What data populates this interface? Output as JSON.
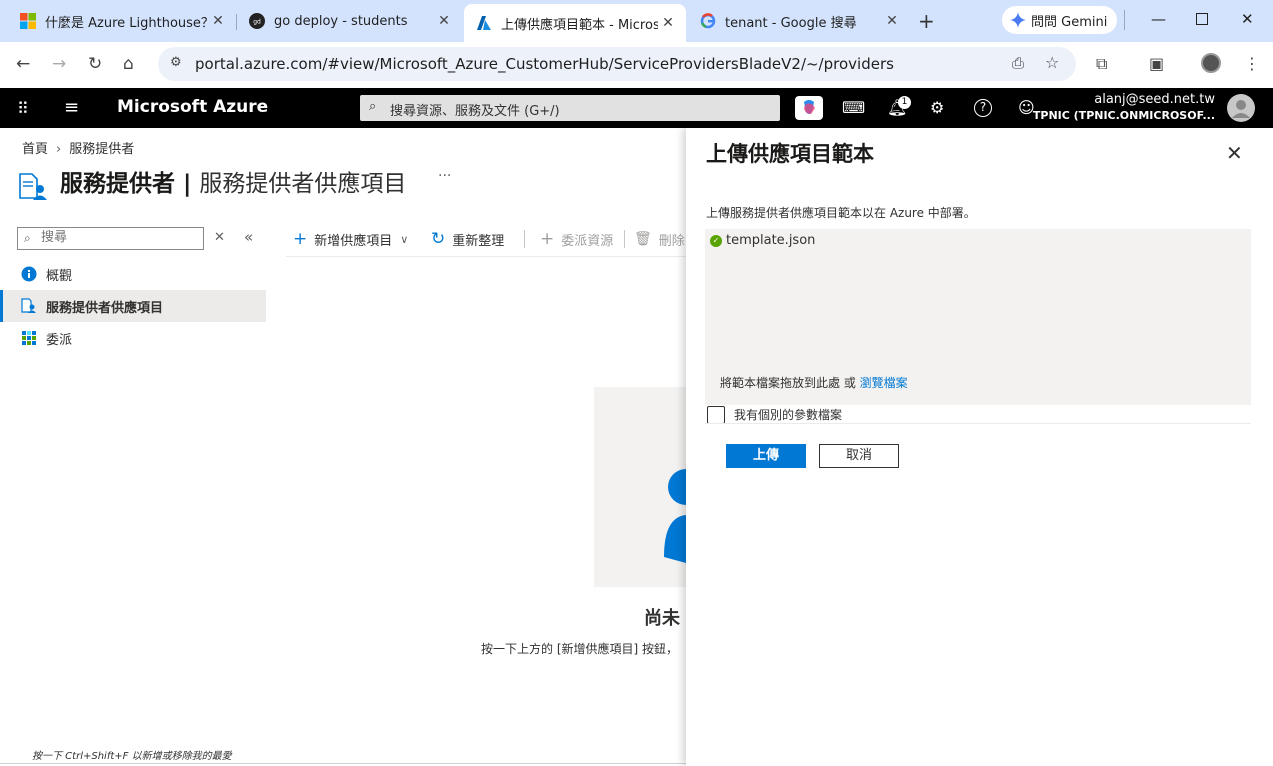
{
  "browser": {
    "tabs": [
      {
        "title": "什麼是 Azure Lighthouse？",
        "icon": "microsoft-icon"
      },
      {
        "title": "go deploy - students",
        "icon": "go-deploy-icon"
      },
      {
        "title": "上傳供應項目範本 - Microso",
        "icon": "azure-icon"
      },
      {
        "title": "tenant - Google 搜尋",
        "icon": "google-icon"
      }
    ],
    "gemini_label": "問問 Gemini",
    "url": "portal.azure.com/#view/Microsoft_Azure_CustomerHub/ServiceProvidersBladeV2/~/providers"
  },
  "azure": {
    "brand": "Microsoft Azure",
    "search_placeholder": "搜尋資源、服務及文件 (G+/)",
    "notification_count": "1",
    "account_email": "alanj@seed.net.tw",
    "account_tenant": "TPNIC (TPNIC.ONMICROSOF..."
  },
  "page": {
    "breadcrumb": [
      "首頁",
      "服務提供者"
    ],
    "title_main": "服務提供者",
    "title_sep": " | ",
    "title_sub": "服務提供者供應項目",
    "more": "···",
    "menu_search_placeholder": "搜尋",
    "menu_items": [
      {
        "label": "概觀",
        "icon": "info-icon"
      },
      {
        "label": "服務提供者供應項目",
        "icon": "service-provider-icon"
      },
      {
        "label": "委派",
        "icon": "delegation-icon"
      }
    ],
    "commands": {
      "add": "新增供應項目",
      "refresh": "重新整理",
      "delegate": "委派資源",
      "delete": "刪除"
    },
    "empty_title": "尚未",
    "empty_desc": "按一下上方的 [新增供應項目] 按鈕，",
    "hint": "按一下 Ctrl+Shift+F 以新增或移除我的最愛"
  },
  "blade": {
    "title": "上傳供應項目範本",
    "description": "上傳服務提供者供應項目範本以在 Azure 中部署。",
    "file_name": "template.json",
    "drop_hint": "將範本檔案拖放到此處 或 ",
    "browse_link": "瀏覽檔案",
    "param_label": "我有個別的參數檔案",
    "upload_button": "上傳",
    "cancel_button": "取消"
  },
  "colors": {
    "accent": "#0078d4",
    "tabstrip": "#d3e3fd",
    "azure_bar": "#000000",
    "success": "#57a300"
  }
}
